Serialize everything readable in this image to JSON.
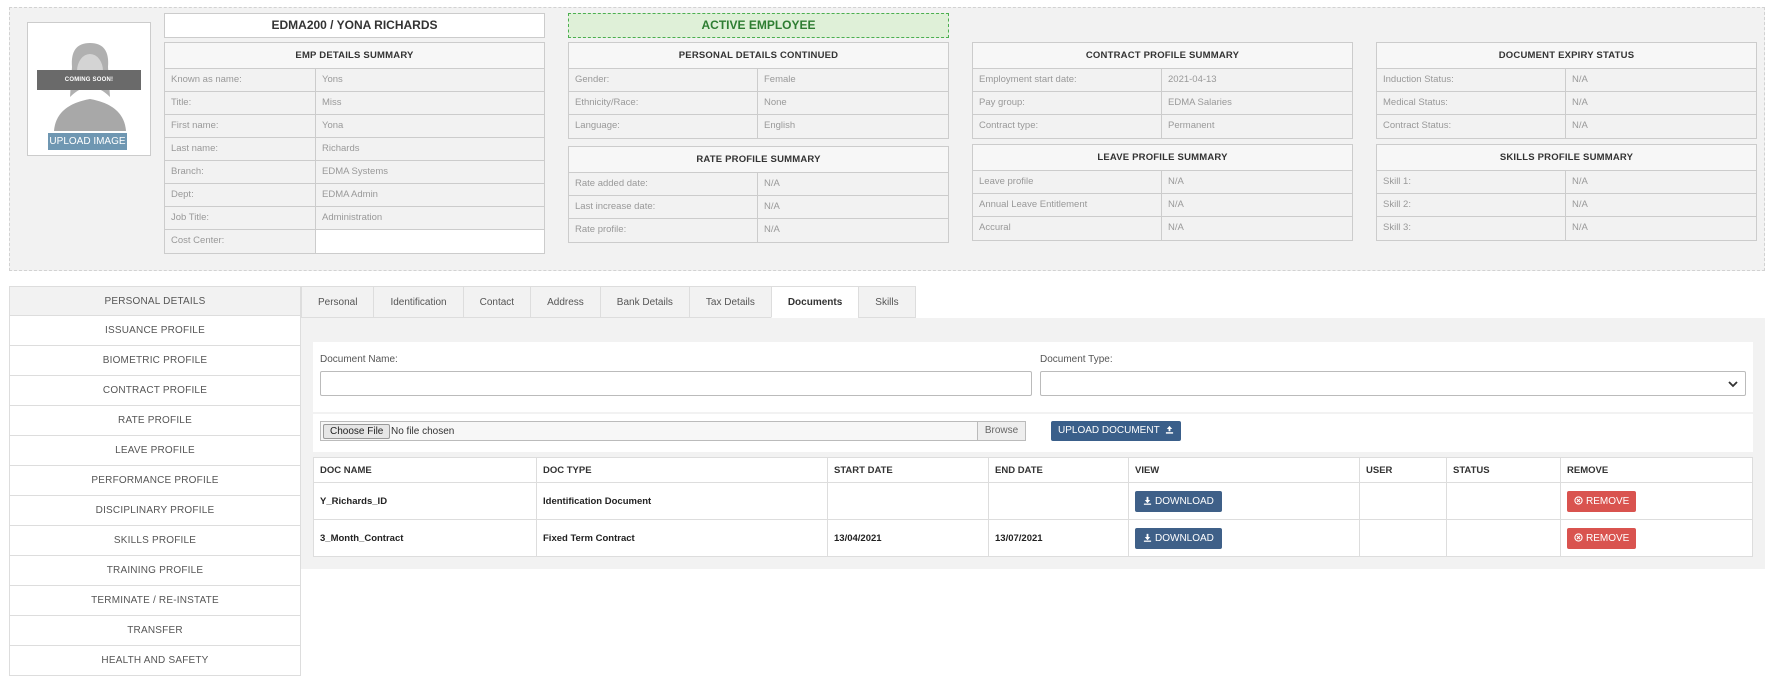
{
  "employee": {
    "header_name": "EDMA200 / YONA RICHARDS",
    "status_badge": "ACTIVE EMPLOYEE",
    "avatar_overlay": "COMING SOON!",
    "upload_image_label": "UPLOAD IMAGE"
  },
  "emp_details": {
    "title": "EMP DETAILS SUMMARY",
    "rows": [
      {
        "label": "Known as name:",
        "value": "Yons"
      },
      {
        "label": "Title:",
        "value": "Miss"
      },
      {
        "label": "First name:",
        "value": "Yona"
      },
      {
        "label": "Last name:",
        "value": "Richards"
      },
      {
        "label": "Branch:",
        "value": "EDMA Systems"
      },
      {
        "label": "Dept:",
        "value": "EDMA Admin"
      },
      {
        "label": "Job Title:",
        "value": "Administration"
      },
      {
        "label": "Cost Center:",
        "value": ""
      }
    ]
  },
  "personal_continued": {
    "title": "PERSONAL DETAILS CONTINUED",
    "rows": [
      {
        "label": "Gender:",
        "value": "Female"
      },
      {
        "label": "Ethnicity/Race:",
        "value": "None"
      },
      {
        "label": "Language:",
        "value": "English"
      }
    ]
  },
  "rate_profile": {
    "title": "RATE PROFILE SUMMARY",
    "rows": [
      {
        "label": "Rate added date:",
        "value": "N/A"
      },
      {
        "label": "Last increase date:",
        "value": "N/A"
      },
      {
        "label": "Rate profile:",
        "value": "N/A"
      }
    ]
  },
  "contract_profile": {
    "title": "CONTRACT PROFILE SUMMARY",
    "rows": [
      {
        "label": "Employment start date:",
        "value": "2021-04-13"
      },
      {
        "label": "Pay group:",
        "value": "EDMA Salaries"
      },
      {
        "label": "Contract type:",
        "value": "Permanent"
      }
    ]
  },
  "leave_profile": {
    "title": "LEAVE PROFILE SUMMARY",
    "rows": [
      {
        "label": "Leave profile",
        "value": "N/A"
      },
      {
        "label": "Annual Leave Entitlement",
        "value": "N/A"
      },
      {
        "label": "Accural",
        "value": "N/A"
      }
    ]
  },
  "document_expiry": {
    "title": "DOCUMENT EXPIRY STATUS",
    "rows": [
      {
        "label": "Induction Status:",
        "value": "N/A"
      },
      {
        "label": "Medical Status:",
        "value": "N/A"
      },
      {
        "label": "Contract Status:",
        "value": "N/A"
      }
    ]
  },
  "skills_profile": {
    "title": "SKILLS PROFILE SUMMARY",
    "rows": [
      {
        "label": "Skill 1:",
        "value": "N/A"
      },
      {
        "label": "Skill 2:",
        "value": "N/A"
      },
      {
        "label": "Skill 3:",
        "value": "N/A"
      }
    ]
  },
  "sidenav": {
    "items": [
      "PERSONAL DETAILS",
      "ISSUANCE PROFILE",
      "BIOMETRIC PROFILE",
      "CONTRACT PROFILE",
      "RATE PROFILE",
      "LEAVE PROFILE",
      "PERFORMANCE PROFILE",
      "DISCIPLINARY PROFILE",
      "SKILLS PROFILE",
      "TRAINING PROFILE",
      "TERMINATE / RE-INSTATE",
      "TRANSFER",
      "HEALTH AND SAFETY"
    ],
    "active": "PERSONAL DETAILS"
  },
  "tabs": {
    "items": [
      "Personal",
      "Identification",
      "Contact",
      "Address",
      "Bank Details",
      "Tax Details",
      "Documents",
      "Skills"
    ],
    "active": "Documents"
  },
  "form": {
    "doc_name_label": "Document Name:",
    "doc_name_value": "",
    "doc_type_label": "Document Type:",
    "doc_type_value": "",
    "choose_file_label": "Choose File",
    "file_status": "No file chosen",
    "browse_label": "Browse",
    "upload_doc_label": "UPLOAD DOCUMENT"
  },
  "documents_table": {
    "columns": [
      "DOC NAME",
      "DOC TYPE",
      "START DATE",
      "END DATE",
      "VIEW",
      "USER",
      "STATUS",
      "REMOVE"
    ],
    "rows": [
      {
        "doc_name": "Y_Richards_ID",
        "doc_type": "Identification Document",
        "start_date": "",
        "end_date": "",
        "view_label": "DOWNLOAD",
        "user": "",
        "status": "",
        "remove_label": "REMOVE"
      },
      {
        "doc_name": "3_Month_Contract",
        "doc_type": "Fixed Term Contract",
        "start_date": "13/04/2021",
        "end_date": "13/07/2021",
        "view_label": "DOWNLOAD",
        "user": "",
        "status": "",
        "remove_label": "REMOVE"
      }
    ]
  },
  "colors": {
    "active_badge_bg": "#dff0d8",
    "active_badge_text": "#2e7d32",
    "primary_button": "#3f6088",
    "danger_button": "#d9534f",
    "upload_image_button": "#6f97b2"
  },
  "icons": {
    "download": "download-icon",
    "remove": "remove-circle-icon",
    "upload": "upload-icon",
    "select": "chevron-down-icon"
  }
}
